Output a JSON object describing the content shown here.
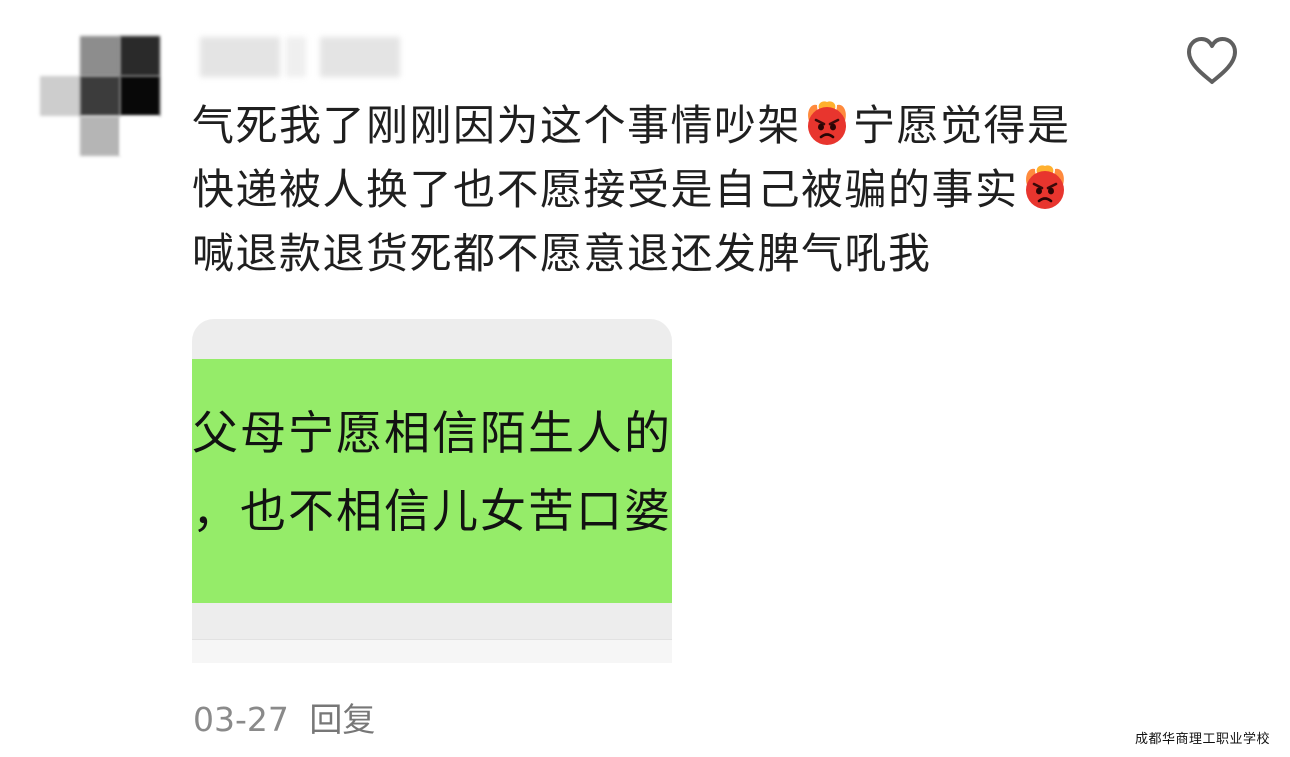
{
  "comment": {
    "author": {
      "avatar_icon": "pixelated-avatar",
      "name_obscured": true
    },
    "segments": [
      {
        "type": "text",
        "value": "气死我了刚刚因为这个事情吵架"
      },
      {
        "type": "emoji",
        "icon": "angry-devil-emoji"
      },
      {
        "type": "text",
        "value": "宁愿觉得是快递被人换了也不愿接受是自己被骗的事实"
      },
      {
        "type": "emoji",
        "icon": "angry-devil-emoji"
      },
      {
        "type": "text",
        "value": "喊退款退货死都不愿意退还发脾气吼我"
      }
    ],
    "attached_image": {
      "line1": "父母宁愿相信陌生人的",
      "line2": "，也不相信儿女苦口婆"
    },
    "date": "03-27",
    "reply_label": "回复",
    "like_icon": "heart-outline-icon"
  },
  "watermark": "成都华商理工职业学校",
  "colors": {
    "bubble_green": "#95ec69",
    "meta_gray": "#8a8a8a",
    "emoji_red": "#e8352e"
  }
}
